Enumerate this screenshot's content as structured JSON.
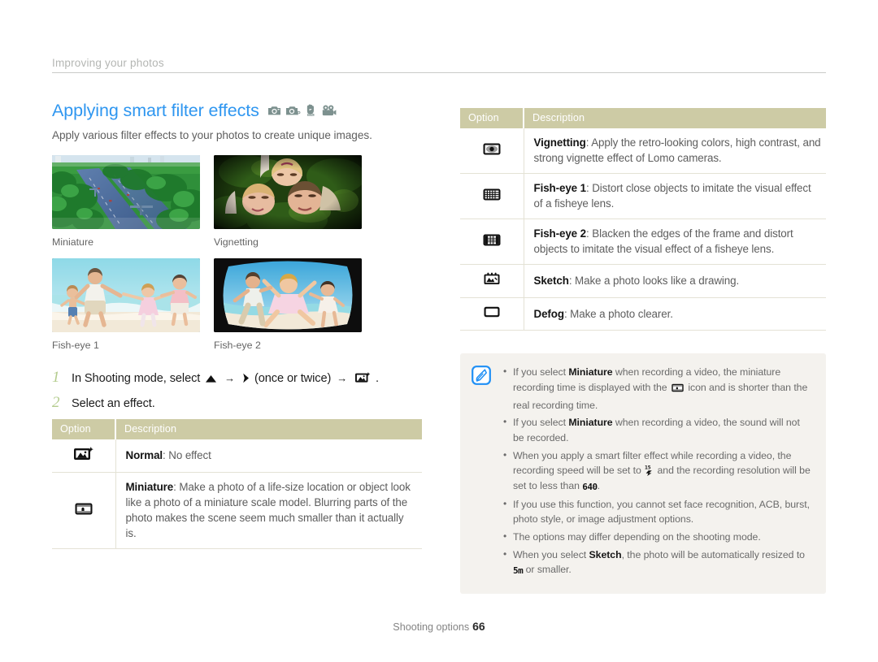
{
  "running_head": "Improving your photos",
  "header": {
    "title": "Applying smart filter effects",
    "mode_icons": [
      "camera-icon",
      "camera-program-icon",
      "dual-is-icon",
      "video-camera-icon"
    ],
    "lede": "Apply various filter effects to your photos to create unique images."
  },
  "samples": [
    {
      "caption": "Miniature",
      "image": "highway-aerial-miniature-photo"
    },
    {
      "caption": "Vignetting",
      "image": "three-people-on-grass-vignette-photo"
    },
    {
      "caption": "Fish-eye 1",
      "image": "family-running-on-beach-photo"
    },
    {
      "caption": "Fish-eye 2",
      "image": "family-on-beach-fisheye-photo"
    }
  ],
  "steps": [
    {
      "number": "1",
      "pre": "In Shooting mode, select",
      "mid": "(once or twice)",
      "post": ".",
      "icons": [
        "up-triangle-icon",
        "right-chevron-icon",
        "smart-filter-icon"
      ]
    },
    {
      "number": "2",
      "pre": "Select an effect.",
      "mid": "",
      "post": "",
      "icons": []
    }
  ],
  "left_table": {
    "headers": [
      "Option",
      "Description"
    ],
    "rows": [
      {
        "icon": "smart-filter-normal-icon",
        "name": "Normal",
        "desc": ": No effect"
      },
      {
        "icon": "miniature-icon",
        "name": "Miniature",
        "desc": ": Make a photo of a life-size location or object look like a photo of a miniature scale model. Blurring parts of the photo makes the scene seem much smaller than it actually is."
      }
    ]
  },
  "right_table": {
    "headers": [
      "Option",
      "Description"
    ],
    "rows": [
      {
        "icon": "vignetting-icon",
        "name": "Vignetting",
        "desc": ": Apply the retro-looking colors, high contrast, and strong vignette effect of Lomo cameras."
      },
      {
        "icon": "fisheye1-icon",
        "name": "Fish-eye 1",
        "desc": ": Distort close objects to imitate the visual effect of a fisheye lens."
      },
      {
        "icon": "fisheye2-icon",
        "name": "Fish-eye 2",
        "desc": ": Blacken the edges of the frame and distort objects to imitate the visual effect of a fisheye lens."
      },
      {
        "icon": "sketch-icon",
        "name": "Sketch",
        "desc": ": Make a photo looks like a drawing."
      },
      {
        "icon": "defog-icon",
        "name": "Defog",
        "desc": ": Make a photo clearer."
      }
    ]
  },
  "note": {
    "icon": "note-pen-icon",
    "items": [
      {
        "p1": "If you select ",
        "b1": "Miniature",
        "p2": " when recording a video, the miniature recording time is displayed with the ",
        "icon": "miniature-icon",
        "p3": " icon and is shorter than the real recording time."
      },
      {
        "p1": "If you select ",
        "b1": "Miniature",
        "p2": " when recording a video, the sound will not be recorded.",
        "p3": ""
      },
      {
        "p1": "When you apply a smart filter effect while recording a video, the recording speed will be set to ",
        "badge1": "15fps-icon",
        "p2": " and the recording resolution will be set to less than ",
        "badge2": "640",
        "p3": "."
      },
      {
        "p1": "If you use this function, you cannot set face recognition, ACB, burst, photo style, or image adjustment options.",
        "p2": "",
        "p3": ""
      },
      {
        "p1": "The options may differ depending on the shooting mode.",
        "p2": "",
        "p3": ""
      },
      {
        "p1": "When you select ",
        "b1": "Sketch",
        "p2": ", the photo will be automatically resized to ",
        "badge2": "5m",
        "p3": " or smaller."
      }
    ]
  },
  "footer": {
    "label": "Shooting options",
    "page": "66"
  },
  "colors": {
    "title": "#2e96f0",
    "table_header": "#cdcba5",
    "note_bg": "#f4f2ee",
    "step_number": "#b4cc8e",
    "body_text": "#5d5d5d"
  }
}
